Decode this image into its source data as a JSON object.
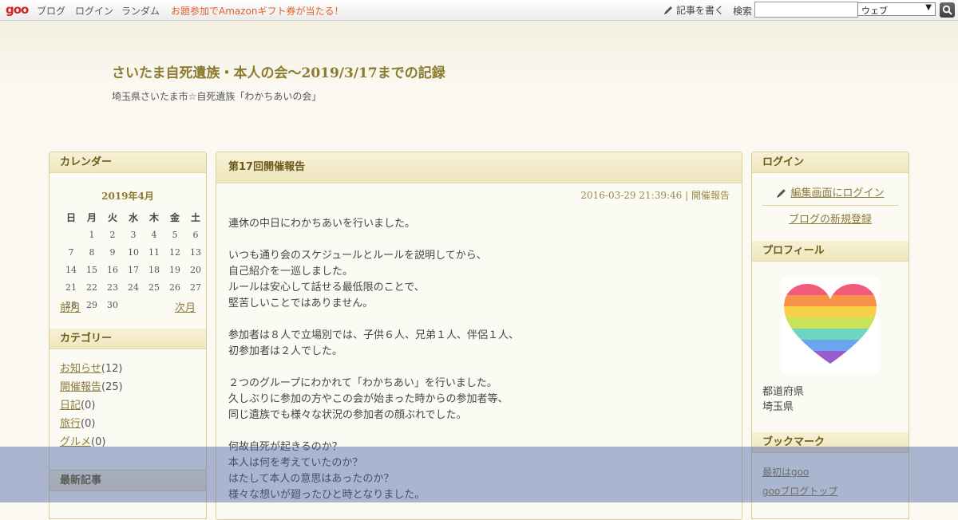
{
  "topbar": {
    "logo": "goo",
    "nav": [
      "ブログ",
      "ログイン",
      "ランダム"
    ],
    "promo": "お題参加でAmazonギフト券が当たる！",
    "write_label": "記事を書く",
    "search_label": "検索",
    "search_value": "",
    "search_scope": "ウェブ"
  },
  "header": {
    "title": "さいたま自死遺族・本人の会～2019/3/17までの記録",
    "description": "埼玉県さいたま市☆自死遺族「わかちあいの会」"
  },
  "calendar": {
    "heading": "カレンダー",
    "month": "2019年4月",
    "weekdays": [
      "日",
      "月",
      "火",
      "水",
      "木",
      "金",
      "土"
    ],
    "weeks": [
      [
        "",
        "1",
        "2",
        "3",
        "4",
        "5",
        "6"
      ],
      [
        "7",
        "8",
        "9",
        "10",
        "11",
        "12",
        "13"
      ],
      [
        "14",
        "15",
        "16",
        "17",
        "18",
        "19",
        "20"
      ],
      [
        "21",
        "22",
        "23",
        "24",
        "25",
        "26",
        "27"
      ],
      [
        "28",
        "29",
        "30",
        "",
        "",
        "",
        ""
      ]
    ],
    "prev": "前月",
    "next": "次月"
  },
  "categories": {
    "heading": "カテゴリー",
    "items": [
      {
        "name": "お知らせ",
        "count": "(12)"
      },
      {
        "name": "開催報告",
        "count": "(25)"
      },
      {
        "name": "日記",
        "count": "(0)"
      },
      {
        "name": "旅行",
        "count": "(0)"
      },
      {
        "name": "グルメ",
        "count": "(0)"
      }
    ]
  },
  "recent": {
    "heading": "最新記事"
  },
  "article": {
    "title": "第17回開催報告",
    "date": "2016-03-29 21:39:46",
    "separator": "|",
    "category": "開催報告",
    "body": "連休の中日にわかちあいを行いました。\n\nいつも通り会のスケジュールとルールを説明してから、\n自己紹介を一巡しました。\nルールは安心して話せる最低限のことで、\n堅苦しいことではありません。\n\n参加者は８人で立場別では、子供６人、兄弟１人、伴侶１人、\n初参加者は２人でした。\n\n２つのグループにわかれて「わかちあい」を行いました。\n久しぶりに参加の方やこの会が始まった時からの参加者等、\n同じ遺族でも様々な状況の参加者の顔ぶれでした。\n\n何故自死が起きるのか？\n本人は何を考えていたのか？\nはたして本人の意思はあったのか？\n様々な想いが廻ったひと時となりました。"
  },
  "login": {
    "heading": "ログイン",
    "edit_login": "編集画面にログイン",
    "new_blog": "ブログの新規登録"
  },
  "profile": {
    "heading": "プロフィール",
    "pref_label": "都道府県",
    "pref_value": "埼玉県"
  },
  "bookmarks": {
    "heading": "ブックマーク",
    "items": [
      "最初はgoo",
      "gooブログトップ"
    ]
  },
  "colors": {
    "accent": "#8c7b2f",
    "link": "#8a7a3a",
    "promo": "#e0602a",
    "logo": "#d2232a"
  }
}
